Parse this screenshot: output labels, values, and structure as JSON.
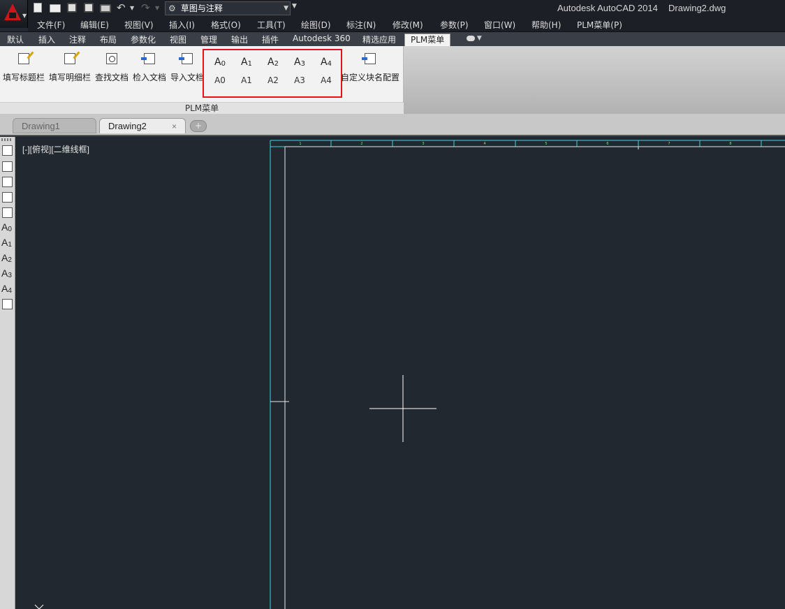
{
  "title_bar": {
    "app_title": "Autodesk AutoCAD 2014",
    "doc_title": "Drawing2.dwg",
    "workspace": "草图与注释"
  },
  "menu": [
    {
      "label": "文件(F)"
    },
    {
      "label": "编辑(E)"
    },
    {
      "label": "视图(V)"
    },
    {
      "label": "插入(I)"
    },
    {
      "label": "格式(O)"
    },
    {
      "label": "工具(T)"
    },
    {
      "label": "绘图(D)"
    },
    {
      "label": "标注(N)"
    },
    {
      "label": "修改(M)"
    },
    {
      "label": "参数(P)"
    },
    {
      "label": "窗口(W)"
    },
    {
      "label": "帮助(H)"
    },
    {
      "label": "PLM菜单(P)"
    }
  ],
  "ribbon_tabs": [
    {
      "label": "默认"
    },
    {
      "label": "插入"
    },
    {
      "label": "注释"
    },
    {
      "label": "布局"
    },
    {
      "label": "参数化"
    },
    {
      "label": "视图"
    },
    {
      "label": "管理"
    },
    {
      "label": "输出"
    },
    {
      "label": "插件"
    },
    {
      "label": "Autodesk 360"
    },
    {
      "label": "精选应用"
    },
    {
      "label": "PLM菜单",
      "active": true
    }
  ],
  "panel": {
    "title": "PLM菜单",
    "buttons": [
      {
        "label": "填写标题栏",
        "icon": "edit-icon"
      },
      {
        "label": "填写明细栏",
        "icon": "edit-icon"
      },
      {
        "label": "查找文档",
        "icon": "find-icon"
      },
      {
        "label": "检入文档",
        "icon": "checkin-icon"
      },
      {
        "label": "导入文档",
        "icon": "import-icon"
      }
    ],
    "sizes": [
      {
        "letter": "A",
        "digit": "0",
        "label": "A0"
      },
      {
        "letter": "A",
        "digit": "1",
        "label": "A1"
      },
      {
        "letter": "A",
        "digit": "2",
        "label": "A2"
      },
      {
        "letter": "A",
        "digit": "3",
        "label": "A3"
      },
      {
        "letter": "A",
        "digit": "4",
        "label": "A4"
      }
    ],
    "config_button": {
      "label": "自定义块名配置",
      "icon": "config-icon"
    },
    "highlight_color": "#e4141b"
  },
  "file_tabs": [
    {
      "label": "Drawing1",
      "active": false
    },
    {
      "label": "Drawing2",
      "active": true,
      "close": "×"
    }
  ],
  "viewport": {
    "label": "[-][俯视][二维线框]"
  },
  "left_toolbar": {
    "sizes": [
      {
        "letter": "A",
        "digit": "0"
      },
      {
        "letter": "A",
        "digit": "1"
      },
      {
        "letter": "A",
        "digit": "2"
      },
      {
        "letter": "A",
        "digit": "3"
      },
      {
        "letter": "A",
        "digit": "4"
      }
    ]
  },
  "drawing": {
    "frame_color": "#3fd6e0",
    "zone_numbers": [
      "1",
      "2",
      "3",
      "4",
      "5",
      "6",
      "7",
      "8"
    ],
    "background": "#212830"
  }
}
